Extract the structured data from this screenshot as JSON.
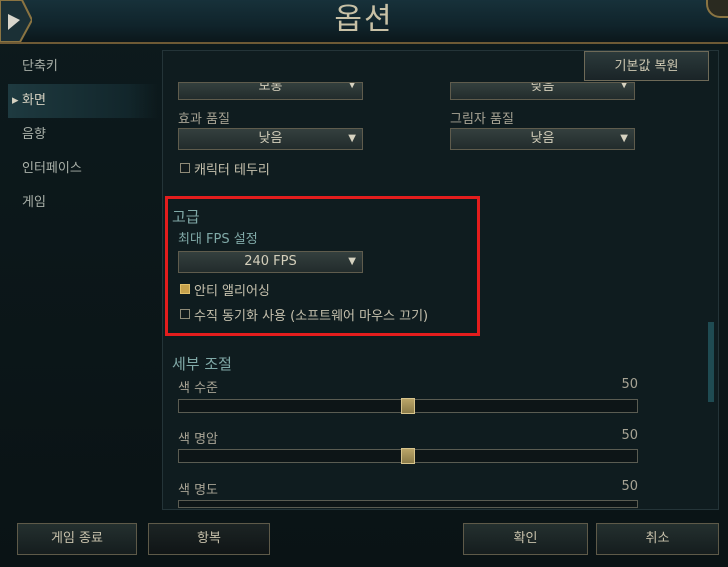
{
  "window": {
    "title": "옵션"
  },
  "sidebar": {
    "items": [
      {
        "label": "단축키",
        "active": false
      },
      {
        "label": "화면",
        "active": true
      },
      {
        "label": "음향",
        "active": false
      },
      {
        "label": "인터페이스",
        "active": false
      },
      {
        "label": "게임",
        "active": false
      }
    ]
  },
  "toolbar": {
    "restore_label": "기본값 복원"
  },
  "graphics": {
    "top_left_value": "보통",
    "top_right_value": "낮음",
    "effects_label": "효과 품질",
    "effects_value": "낮음",
    "shadow_label": "그림자 품질",
    "shadow_value": "낮음",
    "character_border_label": "캐릭터 테두리",
    "character_border_checked": false
  },
  "advanced": {
    "title": "고급",
    "fps_label": "최대 FPS 설정",
    "fps_value": "240 FPS",
    "antialias_label": "안티 앨리어싱",
    "antialias_checked": true,
    "vsync_label": "수직 동기화 사용 (소프트웨어 마우스 끄기)",
    "vsync_checked": false
  },
  "fine_tuning": {
    "title": "세부 조절",
    "sliders": [
      {
        "label": "색 수준",
        "value": "50",
        "fraction": 0.5
      },
      {
        "label": "색 명암",
        "value": "50",
        "fraction": 0.5
      },
      {
        "label": "색 명도",
        "value": "50",
        "fraction": 0.5
      }
    ]
  },
  "footer": {
    "exit_label": "게임 종료",
    "surrender_label": "항복",
    "ok_label": "확인",
    "cancel_label": "취소"
  },
  "colors": {
    "highlight_box": "#e31d1d",
    "accent_teal": "#80a9a7",
    "gold": "#c7a24c"
  },
  "icons": {
    "dropdown": "triangle-down",
    "checkbox": "square"
  }
}
